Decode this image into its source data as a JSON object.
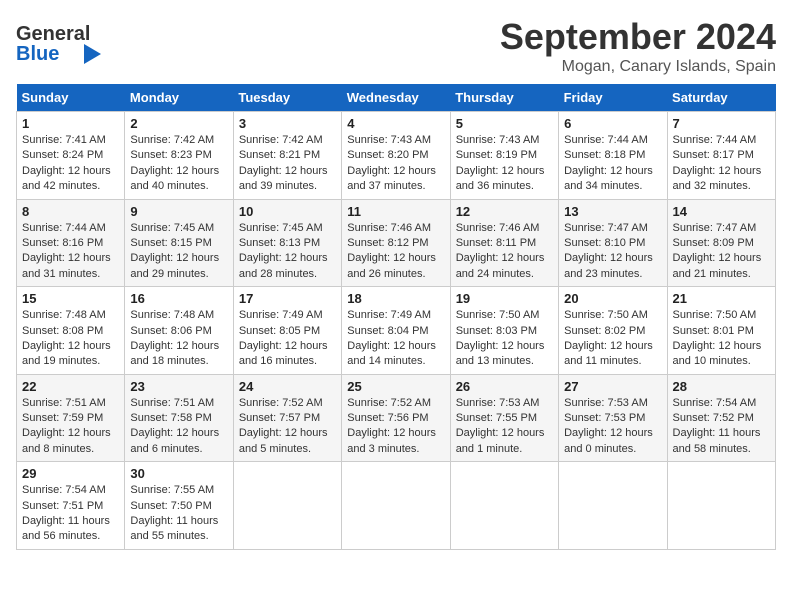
{
  "header": {
    "logo_line1": "General",
    "logo_line2": "Blue",
    "month": "September 2024",
    "location": "Mogan, Canary Islands, Spain"
  },
  "days_of_week": [
    "Sunday",
    "Monday",
    "Tuesday",
    "Wednesday",
    "Thursday",
    "Friday",
    "Saturday"
  ],
  "weeks": [
    [
      {
        "day": "1",
        "sunrise": "Sunrise: 7:41 AM",
        "sunset": "Sunset: 8:24 PM",
        "daylight": "Daylight: 12 hours and 42 minutes."
      },
      {
        "day": "2",
        "sunrise": "Sunrise: 7:42 AM",
        "sunset": "Sunset: 8:23 PM",
        "daylight": "Daylight: 12 hours and 40 minutes."
      },
      {
        "day": "3",
        "sunrise": "Sunrise: 7:42 AM",
        "sunset": "Sunset: 8:21 PM",
        "daylight": "Daylight: 12 hours and 39 minutes."
      },
      {
        "day": "4",
        "sunrise": "Sunrise: 7:43 AM",
        "sunset": "Sunset: 8:20 PM",
        "daylight": "Daylight: 12 hours and 37 minutes."
      },
      {
        "day": "5",
        "sunrise": "Sunrise: 7:43 AM",
        "sunset": "Sunset: 8:19 PM",
        "daylight": "Daylight: 12 hours and 36 minutes."
      },
      {
        "day": "6",
        "sunrise": "Sunrise: 7:44 AM",
        "sunset": "Sunset: 8:18 PM",
        "daylight": "Daylight: 12 hours and 34 minutes."
      },
      {
        "day": "7",
        "sunrise": "Sunrise: 7:44 AM",
        "sunset": "Sunset: 8:17 PM",
        "daylight": "Daylight: 12 hours and 32 minutes."
      }
    ],
    [
      {
        "day": "8",
        "sunrise": "Sunrise: 7:44 AM",
        "sunset": "Sunset: 8:16 PM",
        "daylight": "Daylight: 12 hours and 31 minutes."
      },
      {
        "day": "9",
        "sunrise": "Sunrise: 7:45 AM",
        "sunset": "Sunset: 8:15 PM",
        "daylight": "Daylight: 12 hours and 29 minutes."
      },
      {
        "day": "10",
        "sunrise": "Sunrise: 7:45 AM",
        "sunset": "Sunset: 8:13 PM",
        "daylight": "Daylight: 12 hours and 28 minutes."
      },
      {
        "day": "11",
        "sunrise": "Sunrise: 7:46 AM",
        "sunset": "Sunset: 8:12 PM",
        "daylight": "Daylight: 12 hours and 26 minutes."
      },
      {
        "day": "12",
        "sunrise": "Sunrise: 7:46 AM",
        "sunset": "Sunset: 8:11 PM",
        "daylight": "Daylight: 12 hours and 24 minutes."
      },
      {
        "day": "13",
        "sunrise": "Sunrise: 7:47 AM",
        "sunset": "Sunset: 8:10 PM",
        "daylight": "Daylight: 12 hours and 23 minutes."
      },
      {
        "day": "14",
        "sunrise": "Sunrise: 7:47 AM",
        "sunset": "Sunset: 8:09 PM",
        "daylight": "Daylight: 12 hours and 21 minutes."
      }
    ],
    [
      {
        "day": "15",
        "sunrise": "Sunrise: 7:48 AM",
        "sunset": "Sunset: 8:08 PM",
        "daylight": "Daylight: 12 hours and 19 minutes."
      },
      {
        "day": "16",
        "sunrise": "Sunrise: 7:48 AM",
        "sunset": "Sunset: 8:06 PM",
        "daylight": "Daylight: 12 hours and 18 minutes."
      },
      {
        "day": "17",
        "sunrise": "Sunrise: 7:49 AM",
        "sunset": "Sunset: 8:05 PM",
        "daylight": "Daylight: 12 hours and 16 minutes."
      },
      {
        "day": "18",
        "sunrise": "Sunrise: 7:49 AM",
        "sunset": "Sunset: 8:04 PM",
        "daylight": "Daylight: 12 hours and 14 minutes."
      },
      {
        "day": "19",
        "sunrise": "Sunrise: 7:50 AM",
        "sunset": "Sunset: 8:03 PM",
        "daylight": "Daylight: 12 hours and 13 minutes."
      },
      {
        "day": "20",
        "sunrise": "Sunrise: 7:50 AM",
        "sunset": "Sunset: 8:02 PM",
        "daylight": "Daylight: 12 hours and 11 minutes."
      },
      {
        "day": "21",
        "sunrise": "Sunrise: 7:50 AM",
        "sunset": "Sunset: 8:01 PM",
        "daylight": "Daylight: 12 hours and 10 minutes."
      }
    ],
    [
      {
        "day": "22",
        "sunrise": "Sunrise: 7:51 AM",
        "sunset": "Sunset: 7:59 PM",
        "daylight": "Daylight: 12 hours and 8 minutes."
      },
      {
        "day": "23",
        "sunrise": "Sunrise: 7:51 AM",
        "sunset": "Sunset: 7:58 PM",
        "daylight": "Daylight: 12 hours and 6 minutes."
      },
      {
        "day": "24",
        "sunrise": "Sunrise: 7:52 AM",
        "sunset": "Sunset: 7:57 PM",
        "daylight": "Daylight: 12 hours and 5 minutes."
      },
      {
        "day": "25",
        "sunrise": "Sunrise: 7:52 AM",
        "sunset": "Sunset: 7:56 PM",
        "daylight": "Daylight: 12 hours and 3 minutes."
      },
      {
        "day": "26",
        "sunrise": "Sunrise: 7:53 AM",
        "sunset": "Sunset: 7:55 PM",
        "daylight": "Daylight: 12 hours and 1 minute."
      },
      {
        "day": "27",
        "sunrise": "Sunrise: 7:53 AM",
        "sunset": "Sunset: 7:53 PM",
        "daylight": "Daylight: 12 hours and 0 minutes."
      },
      {
        "day": "28",
        "sunrise": "Sunrise: 7:54 AM",
        "sunset": "Sunset: 7:52 PM",
        "daylight": "Daylight: 11 hours and 58 minutes."
      }
    ],
    [
      {
        "day": "29",
        "sunrise": "Sunrise: 7:54 AM",
        "sunset": "Sunset: 7:51 PM",
        "daylight": "Daylight: 11 hours and 56 minutes."
      },
      {
        "day": "30",
        "sunrise": "Sunrise: 7:55 AM",
        "sunset": "Sunset: 7:50 PM",
        "daylight": "Daylight: 11 hours and 55 minutes."
      },
      null,
      null,
      null,
      null,
      null
    ]
  ]
}
